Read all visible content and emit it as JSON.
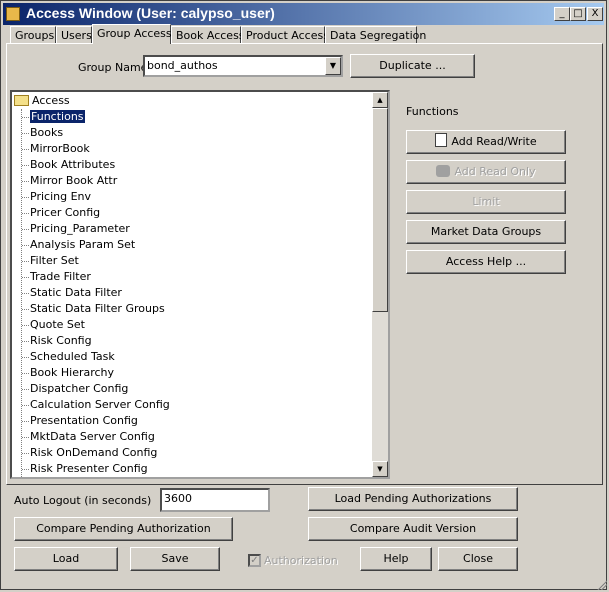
{
  "window": {
    "title": "Access Window (User: calypso_user)",
    "minimize": "_",
    "maximize": "□",
    "close": "X"
  },
  "tabs": [
    "Groups",
    "Users",
    "Group Access",
    "Book Access",
    "Product Access",
    "Data Segregation"
  ],
  "group_name": {
    "label": "Group Name",
    "value": "bond_authos"
  },
  "duplicate_label": "Duplicate ...",
  "tree": {
    "root": "Access",
    "items": [
      "Functions",
      "Books",
      "MirrorBook",
      "Book Attributes",
      "Mirror Book Attr",
      "Pricing Env",
      "Pricer Config",
      "Pricing_Parameter",
      "Analysis Param Set",
      "Filter Set",
      "Trade Filter",
      "Static Data Filter",
      "Static Data Filter Groups",
      "Quote Set",
      "Risk Config",
      "Scheduled Task",
      "Book Hierarchy",
      "Dispatcher Config",
      "Calculation Server Config",
      "Presentation Config",
      "MktData Server Config",
      "Risk OnDemand Config",
      "Risk Presenter Config"
    ],
    "selected": "Functions"
  },
  "functions": {
    "heading": "Functions",
    "add_read_write": "Add Read/Write",
    "add_read_only": "Add Read Only",
    "limit": "Limit",
    "market_data_groups": "Market Data Groups",
    "access_help": "Access Help ..."
  },
  "auto_logout": {
    "label": "Auto Logout (in seconds)",
    "value": "3600"
  },
  "bottom": {
    "load_pending": "Load Pending Authorizations",
    "compare_pending": "Compare Pending Authorization",
    "compare_audit": "Compare Audit Version",
    "load": "Load",
    "save": "Save",
    "authorization": "Authorization",
    "help": "Help",
    "close": "Close"
  }
}
